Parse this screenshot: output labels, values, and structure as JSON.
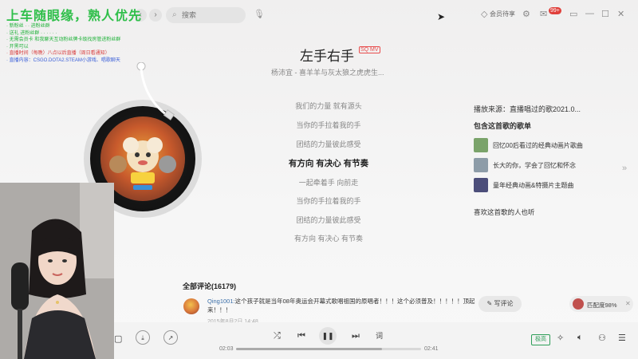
{
  "overlay": {
    "title": "上车随眼缘，熟人优先",
    "lines": [
      {
        "text": "· 新粉丝 · · 进粉丝群",
        "color": "green"
      },
      {
        "text": "· 送礼 进粉丝群 · · · · · ·",
        "color": "green"
      },
      {
        "text": "· 无需会员卡 和我聊天互动粉丝牌卡级找房管进粉丝群",
        "color": "green"
      },
      {
        "text": "· 开黑可以",
        "color": "green"
      },
      {
        "text": "· 直播时间（每晚）八点以后直播（周日看通知）",
        "color": "red"
      },
      {
        "text": "· 直播内容：CSGO.DOTA2.STEAM小游戏、唱歌聊天",
        "color": "blue"
      }
    ]
  },
  "topbar": {
    "back": "‹",
    "forward": "›",
    "search_placeholder": "搜索",
    "vip_label": "会员待享",
    "message_badge": "99+"
  },
  "song": {
    "title": "左手右手",
    "tag": "SQ MV",
    "artist": "杨沛宜 - 喜羊羊与灰太狼之虎虎生..."
  },
  "lyrics": [
    {
      "text": "我们的力量 就有源头",
      "current": false
    },
    {
      "text": "当你的手拉着我的手",
      "current": false
    },
    {
      "text": "团结的力量彼此感受",
      "current": false
    },
    {
      "text": "有方向 有决心 有节奏",
      "current": true
    },
    {
      "text": "一起牵着手 向前走",
      "current": false
    },
    {
      "text": "当你的手拉着我的手",
      "current": false
    },
    {
      "text": "团结的力量彼此感受",
      "current": false
    },
    {
      "text": "有方向 有决心 有节奏",
      "current": false
    }
  ],
  "right_panel": {
    "source": "播放来源：直播唱过的歌2021.0...",
    "playlist_heading": "包含这首歌的歌单",
    "playlists": [
      {
        "label": "回忆00后看过的经典动画片歌曲",
        "color": "#7aa36a"
      },
      {
        "label": "长大的你，学会了回忆和怀念",
        "color": "#8d9ca8"
      },
      {
        "label": "童年经典动画&特摄片主题曲",
        "color": "#4c4e7a"
      }
    ],
    "likes_label": "喜欢这首歌的人也听"
  },
  "comments": {
    "heading": "全部评论(16179)",
    "user": "Qing1001:",
    "text": "这个孩子就是当年08年奥运会开幕式歌唱祖国的原唱者！！！这个必须普及！！！！！顶起来！！！",
    "meta": "2015年8月2日 14:48",
    "write_label": "写评论",
    "match_label": "匹配度98%"
  },
  "player": {
    "time_current": "02:03",
    "time_total": "02:41",
    "progress": 0.79,
    "quality_label": "极高",
    "lyric_btn": "词"
  }
}
